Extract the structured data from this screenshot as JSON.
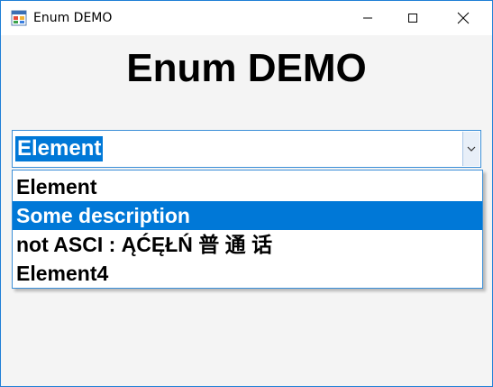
{
  "window": {
    "title": "Enum DEMO",
    "controls": {
      "minimize_icon": "minimize-icon",
      "maximize_icon": "maximize-icon",
      "close_icon": "close-icon"
    }
  },
  "main": {
    "heading": "Enum DEMO",
    "combo": {
      "selected_value": "Element",
      "arrow_icon": "chevron-down-icon",
      "options": [
        {
          "label": "Element",
          "highlighted": false
        },
        {
          "label": "Some description",
          "highlighted": true
        },
        {
          "label": "not ASCI : ĄĆĘŁŃ  普 通 话",
          "highlighted": false
        },
        {
          "label": "Element4",
          "highlighted": false
        }
      ]
    }
  },
  "colors": {
    "accent": "#0078d7",
    "window_bg": "#f4f4f4",
    "border": "#3b8fd8"
  }
}
